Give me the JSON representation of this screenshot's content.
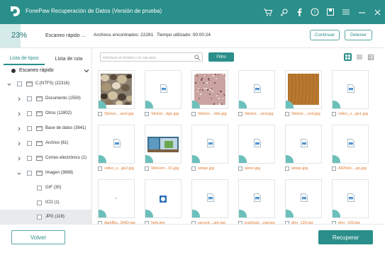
{
  "app": {
    "title": "FonePaw Recuperación de Datos (Versión de prueba)",
    "accent_color": "#2a8e8a",
    "titlebar_icons": [
      "cart-icon",
      "key-icon",
      "facebook-icon",
      "chat-icon",
      "save-icon",
      "menu-icon",
      "minimize-icon",
      "close-icon"
    ]
  },
  "progress": {
    "percent_label": "23%",
    "percent_value": 23,
    "scan_label": "Escaneo rápido ...",
    "found": "Archivos encontrados: 22281",
    "elapsed": "Tiempo utilizado: 00:00:24",
    "continue_label": "Continuar",
    "stop_label": "Detener"
  },
  "sidebar": {
    "tab_types": "Lista de tipos",
    "tab_path": "Lista de ruta",
    "scan_mode": "Escaneo rápido",
    "tree": [
      {
        "label": "C:(NTFS) (22316)",
        "icon": "drive-icon"
      },
      {
        "label": "Documento (1559)",
        "icon": "document-icon"
      },
      {
        "label": "Otros (12802)",
        "icon": "folder-icon"
      },
      {
        "label": "Base de datos (3841)",
        "icon": "database-icon"
      },
      {
        "label": "Archivo (61)",
        "icon": "archive-icon"
      },
      {
        "label": "Correo electrónico (1)",
        "icon": "email-icon"
      },
      {
        "label": "Imagen (3888)",
        "icon": "image-icon"
      },
      {
        "label": "GIF (30)",
        "icon": ""
      },
      {
        "label": "ICO (1)",
        "icon": ""
      },
      {
        "label": "JPG (116)",
        "icon": ""
      }
    ]
  },
  "toolbar": {
    "search_placeholder": "Introducir el nombre y la ruta aquí",
    "filter_label": "Filtro"
  },
  "files": [
    {
      "name": "Sticker....avel.jpg",
      "thumb": "pebbles"
    },
    {
      "name": "Sticker...dge.jpg",
      "thumb": "file"
    },
    {
      "name": "Sticker....rble.jpg",
      "thumb": "granite"
    },
    {
      "name": "Sticker....and.jpg",
      "thumb": "file"
    },
    {
      "name": "Sticker....ood.jpg",
      "thumb": "wood"
    },
    {
      "name": "video_o...ge1.jpg",
      "thumb": "file"
    },
    {
      "name": "video_o...ge2.jpg",
      "thumb": "file"
    },
    {
      "name": "Welcom...01.jpg",
      "thumb": "welcome"
    },
    {
      "name": "winpe.jpg",
      "thumb": "file"
    },
    {
      "name": "winre.jpg",
      "thumb": "file"
    },
    {
      "name": "winpe.jpg",
      "thumb": "file"
    },
    {
      "name": "ASPdot....go.jpg",
      "thumb": "file"
    },
    {
      "name": "darkBlu...RAD.jpg",
      "thumb": "blank"
    },
    {
      "name": "help.jpg",
      "thumb": "help"
    },
    {
      "name": "securit....ark.jpg",
      "thumb": "file"
    },
    {
      "name": "topGrad....eat.jpg",
      "thumb": "file"
    },
    {
      "name": "dmr_120.jpg",
      "thumb": "file"
    },
    {
      "name": "dmr_120.jpg",
      "thumb": "file"
    }
  ],
  "footer": {
    "back_label": "Volver",
    "recover_label": "Recuperar"
  }
}
